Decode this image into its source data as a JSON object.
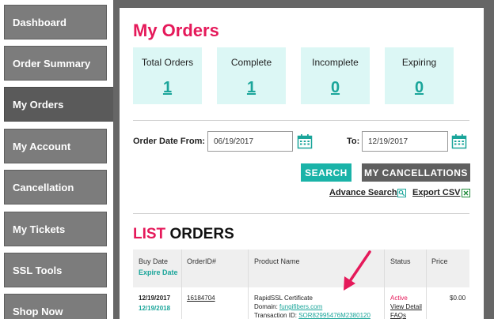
{
  "sidebar": {
    "items": [
      {
        "label": "Dashboard"
      },
      {
        "label": "Order Summary"
      },
      {
        "label": "My Orders"
      },
      {
        "label": "My Account"
      },
      {
        "label": "Cancellation"
      },
      {
        "label": "My Tickets"
      },
      {
        "label": "SSL Tools"
      },
      {
        "label": "Shop Now"
      }
    ],
    "active_index": 2
  },
  "main": {
    "title": "My Orders",
    "stats": [
      {
        "label": "Total Orders",
        "value": "1"
      },
      {
        "label": "Complete",
        "value": "1"
      },
      {
        "label": "Incomplete",
        "value": "0"
      },
      {
        "label": "Expiring",
        "value": "0"
      }
    ],
    "filter": {
      "from_label": "Order Date From:",
      "from_value": "06/19/2017",
      "to_label": "To:",
      "to_value": "12/19/2017",
      "search_button": "SEARCH",
      "cancellations_button": "MY CANCELLATIONS",
      "advance_search": "Advance Search",
      "export_csv": "Export CSV"
    },
    "list": {
      "title_accent": "LIST",
      "title_rest": " ORDERS",
      "columns": {
        "buy_date": "Buy Date",
        "expire_date": "Expire Date",
        "order_id": "OrderID#",
        "product_name": "Product Name",
        "status": "Status",
        "price": "Price"
      },
      "rows": [
        {
          "buy_date": "12/19/2017",
          "expire_date": "12/19/2018",
          "order_id": "16184704",
          "product": "RapidSSL Certificate",
          "domain_label": "Domain:",
          "domain": "fungifibers.com",
          "transaction_label": "Transaction ID:",
          "transaction_id": "SOR82995476M2380120",
          "status": "Active",
          "view_detail": "View Detail",
          "faqs": "FAQs",
          "price": "$0.00"
        }
      ]
    }
  },
  "colors": {
    "accent_pink": "#e5195a",
    "teal": "#1aa59a",
    "card_bg": "#dcf7f5",
    "sidebar_bg": "#7c7c7c"
  }
}
